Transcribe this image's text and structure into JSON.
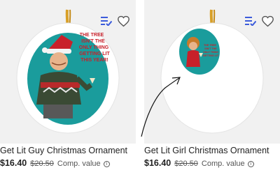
{
  "products": [
    {
      "title": "Get Lit Guy Christmas Ornament",
      "price": "$16.40",
      "original_price": "$20.50",
      "comp_label": "Comp. value",
      "image_text": [
        "THE TREE",
        "ISN'T THE",
        "ONLY THING",
        "GETTING LIT",
        "THIS YEAR!"
      ]
    },
    {
      "title": "Get Lit Girl Christmas Ornament",
      "price": "$16.40",
      "original_price": "$20.50",
      "comp_label": "Comp. value",
      "image_text": [
        "THE TREE",
        "ISN'T THE",
        "ONLY THING",
        "GETTING LIT"
      ]
    }
  ],
  "icons": {
    "compare": "checklist-icon",
    "favorite": "heart-icon",
    "info": "info-icon"
  },
  "colors": {
    "teal": "#1a9c9c",
    "ornament_red": "#c8202a",
    "ribbon_gold": "#d8a028"
  }
}
